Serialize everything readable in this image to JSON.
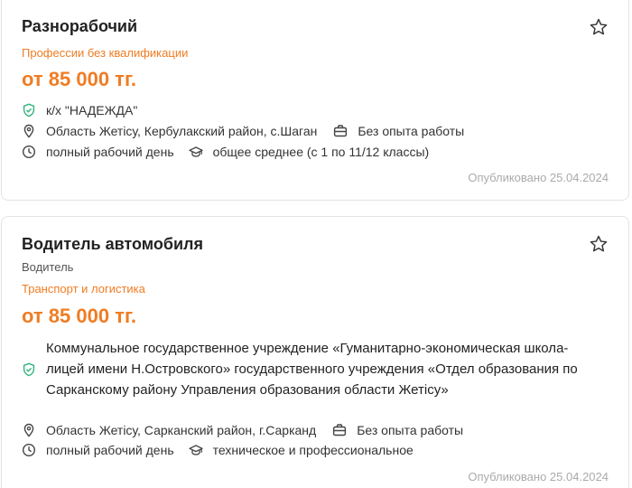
{
  "vacancies": [
    {
      "title": "Разнорабочий",
      "category": "Профессии без квалификации",
      "salary": "от 85 000 тг.",
      "employer": "к/х \"НАДЕЖДА\"",
      "location": "Область Жетісу, Кербулакский район, с.Шаган",
      "experience": "Без опыта работы",
      "schedule": "полный рабочий день",
      "education": "общее среднее (с 1 по 11/12 классы)",
      "published": "Опубликовано 25.04.2024"
    },
    {
      "title": "Водитель автомобиля",
      "subtitle": "Водитель",
      "category": "Транспорт и логистика",
      "salary": "от 85 000 тг.",
      "employer": "Коммунальное государственное учреждение «Гуманитарно-экономическая школа-лицей имени Н.Островского» государственного учреждения «Отдел образования по Сарканскому району Управления образования области Жетісу»",
      "location": "Область Жетісу, Сарканский район, г.Сарканд",
      "experience": "Без опыта работы",
      "schedule": "полный рабочий день",
      "education": "техническое и профессиональное",
      "published": "Опубликовано 25.04.2024"
    }
  ],
  "colors": {
    "accent": "#f07c22",
    "verified": "#2fb37a",
    "muted": "#aaaaaa"
  },
  "icons": [
    "star-icon",
    "shield-check-icon",
    "location-pin-icon",
    "briefcase-icon",
    "clock-icon",
    "graduation-cap-icon"
  ]
}
